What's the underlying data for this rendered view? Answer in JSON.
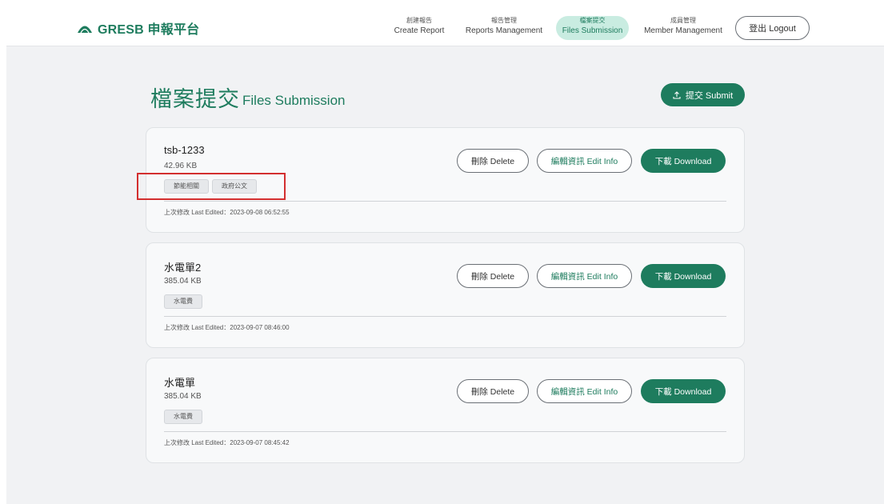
{
  "brand": {
    "name": "GRESB 申報平台",
    "color": "#1e7c5e"
  },
  "nav": [
    {
      "zh": "創建報告",
      "en": "Create Report",
      "active": false
    },
    {
      "zh": "報告管理",
      "en": "Reports Management",
      "active": false
    },
    {
      "zh": "檔案提交",
      "en": "Files Submission",
      "active": true
    },
    {
      "zh": "成員管理",
      "en": "Member Management",
      "active": false
    }
  ],
  "logout_label": "登出 Logout",
  "page": {
    "title_zh": "檔案提交",
    "title_en": "Files Submission",
    "submit_label": "提交 Submit"
  },
  "actions": {
    "delete": "刪除 Delete",
    "edit": "編輯資訊 Edit Info",
    "download": "下載 Download"
  },
  "files": [
    {
      "name": "tsb-1233",
      "size": "42.96 KB",
      "tags": [
        "節能相關",
        "政府公文"
      ],
      "edited": "上次修改 Last Edited：2023-09-08 06:52:55"
    },
    {
      "name": "水電單2",
      "size": "385.04 KB",
      "tags": [
        "水電費"
      ],
      "edited": "上次修改 Last Edited：2023-09-07 08:46:00"
    },
    {
      "name": "水電單",
      "size": "385.04 KB",
      "tags": [
        "水電費"
      ],
      "edited": "上次修改 Last Edited：2023-09-07 08:45:42"
    }
  ],
  "icons": {
    "brand": "dome-logo-icon",
    "submit": "upload-icon"
  },
  "colors": {
    "accent": "#1e7c5e",
    "active_nav_bg": "#c9ece1",
    "highlight": "#d32f2f"
  }
}
